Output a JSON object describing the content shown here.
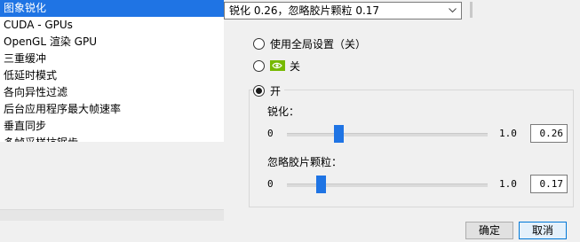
{
  "settings_list": {
    "items": [
      "图象锐化",
      "CUDA - GPUs",
      "OpenGL 渲染 GPU",
      "三重缓冲",
      "低延时模式",
      "各向异性过滤",
      "后台应用程序最大帧速率",
      "垂直同步",
      "多帧采样抗锯齿"
    ],
    "selected_index": 0
  },
  "dropdown": {
    "value": "锐化 0.26，忽略胶片颗粒 0.17",
    "icon": "chevron-down-icon"
  },
  "options": {
    "use_global_label": "使用全局设置（关）",
    "off_label": "关",
    "on_label": "开",
    "selected": "on",
    "sharpen": {
      "label": "锐化：",
      "min": "0",
      "max": "1.0",
      "value": "0.26",
      "fraction": 0.26
    },
    "grain": {
      "label": "忽略胶片颗粒：",
      "min": "0",
      "max": "1.0",
      "value": "0.17",
      "fraction": 0.17
    }
  },
  "buttons": {
    "ok": "确定",
    "cancel": "取消"
  },
  "colors": {
    "accent": "#1f74e4",
    "nvidia_green": "#76b900"
  }
}
